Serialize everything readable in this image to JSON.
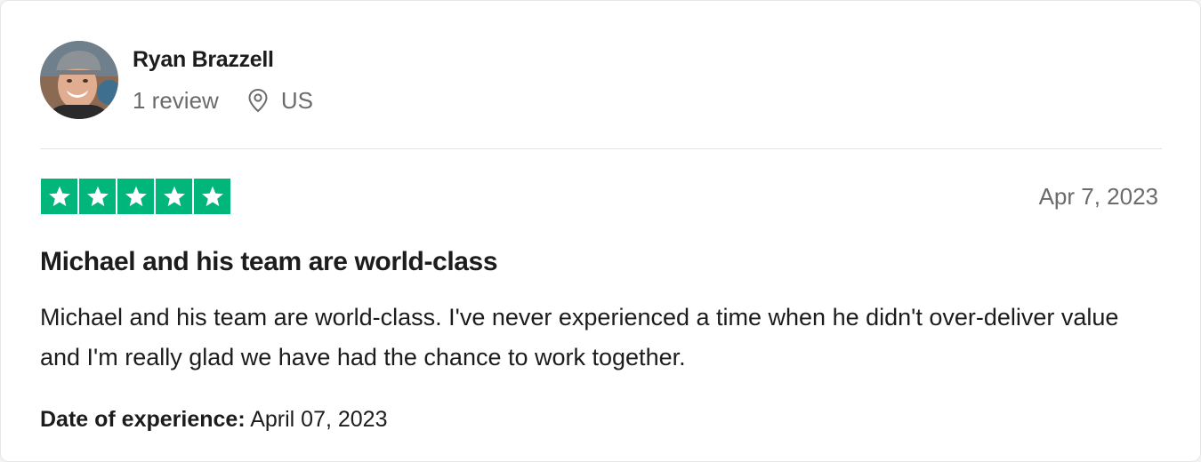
{
  "reviewer": {
    "name": "Ryan Brazzell",
    "review_count": "1 review",
    "location": "US",
    "location_icon": "map-pin-icon"
  },
  "review": {
    "rating": 5,
    "max_rating": 5,
    "star_color": "#00b67a",
    "date": "Apr 7, 2023",
    "title": "Michael and his team are world-class",
    "body": "Michael and his team are world-class. I've never experienced a time when he didn't over-deliver value and I'm really glad we have had the chance to work together.",
    "experience_label": "Date of experience:",
    "experience_date": "April 07, 2023"
  }
}
